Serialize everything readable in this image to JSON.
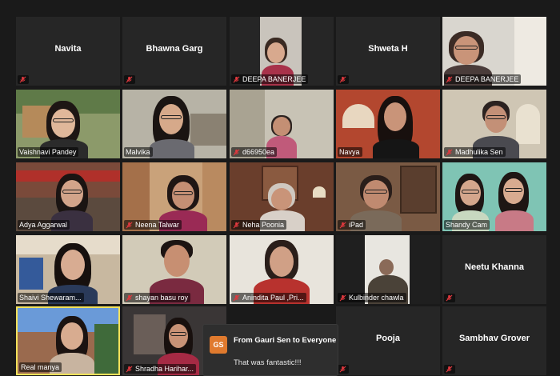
{
  "participants": [
    {
      "name": "Navita",
      "muted": true,
      "video": false
    },
    {
      "name": "Bhawna Garg",
      "muted": true,
      "video": false
    },
    {
      "name": "DEEPA BANERJEE",
      "muted": true,
      "video": true
    },
    {
      "name": "Shweta H",
      "muted": true,
      "video": false
    },
    {
      "name": "DEEPA BANERJEE",
      "muted": true,
      "video": true
    },
    {
      "name": "Vaishnavi Pandey",
      "muted": false,
      "video": true
    },
    {
      "name": "Malvika",
      "muted": false,
      "video": true
    },
    {
      "name": "d66950ea",
      "muted": true,
      "video": true
    },
    {
      "name": "Navya",
      "muted": false,
      "video": true
    },
    {
      "name": "Madhulika Sen",
      "muted": true,
      "video": true
    },
    {
      "name": "Adya Aggarwal",
      "muted": false,
      "video": true
    },
    {
      "name": "Neena Talwar",
      "muted": true,
      "video": true
    },
    {
      "name": "Neha Poonia",
      "muted": true,
      "video": true
    },
    {
      "name": "iPad",
      "muted": true,
      "video": true
    },
    {
      "name": "Shandy Cam",
      "muted": false,
      "video": true
    },
    {
      "name": "Shaivi Shewaram...",
      "muted": false,
      "video": true
    },
    {
      "name": "shayan basu roy",
      "muted": true,
      "video": true
    },
    {
      "name": "Anindita Paul ,Pri...",
      "muted": true,
      "video": true
    },
    {
      "name": "Kulbinder chawla",
      "muted": true,
      "video": true
    },
    {
      "name": "Neetu Khanna",
      "muted": true,
      "video": false
    },
    {
      "name": "Real manya",
      "muted": false,
      "video": true,
      "active": true
    },
    {
      "name": "Shradha Harihar...",
      "muted": true,
      "video": true
    },
    {
      "name": "Pooja",
      "muted": true,
      "video": false
    },
    {
      "name": "Sambhav Grover",
      "muted": true,
      "video": false
    }
  ],
  "chat_toast": {
    "avatar_initials": "GS",
    "from": "From Gauri Sen to Everyone",
    "message": "That was fantastic!!!"
  },
  "colors": {
    "muted_icon": "#e0383e",
    "active_speaker_border": "#f2e15a",
    "avatar_bg": "#e07a2e"
  }
}
